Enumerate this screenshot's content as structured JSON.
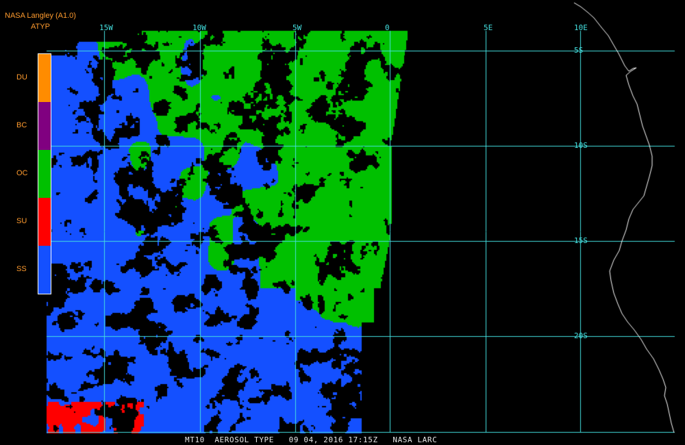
{
  "header": {
    "title": "NASA Langley (A1.0)",
    "product": "ATYP"
  },
  "legend": {
    "items": [
      {
        "code": "DU",
        "color": "#ff8c00"
      },
      {
        "code": "BC",
        "color": "#800080"
      },
      {
        "code": "OC",
        "color": "#00c000"
      },
      {
        "code": "SU",
        "color": "#ff0000"
      },
      {
        "code": "SS",
        "color": "#1450ff"
      }
    ]
  },
  "grid": {
    "longitude_labels": [
      "15W",
      "10W",
      "5W",
      "0",
      "5E",
      "10E"
    ],
    "latitude_labels": [
      "5S",
      "10S",
      "15S",
      "20S"
    ],
    "line_color": "#44e0e0"
  },
  "map_colors": {
    "land_outline": "#ffffff",
    "background": "#000000"
  },
  "footer": {
    "text": "MT10  AEROSOL TYPE   09 04, 2016 17:15Z   NASA LARC"
  }
}
